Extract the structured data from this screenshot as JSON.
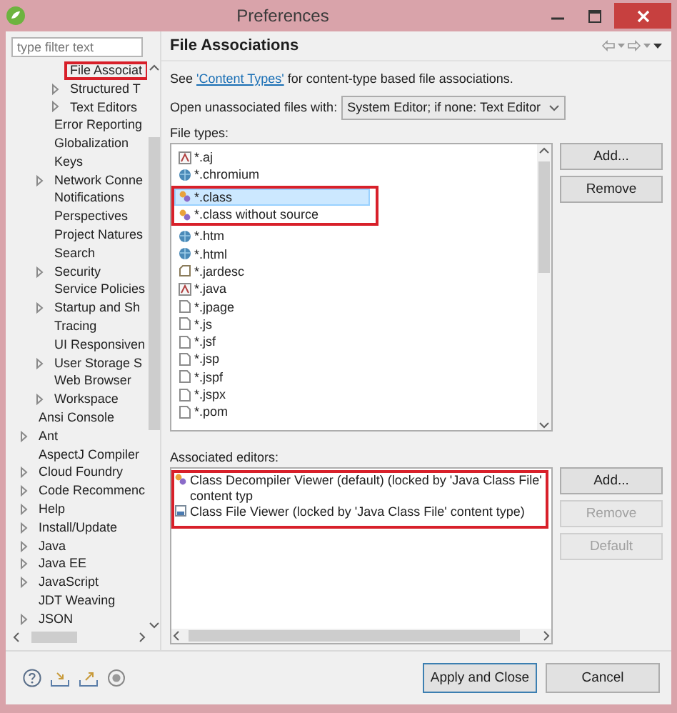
{
  "window": {
    "title": "Preferences"
  },
  "filter": {
    "placeholder": "type filter text"
  },
  "tree": {
    "items": [
      {
        "children": [
          {
            "children": [
              {
                "label": "File Associat",
                "expandable": false,
                "highlighted": true
              },
              {
                "label": "Structured T",
                "expandable": true,
                "highlighted": false
              },
              {
                "label": "Text Editors",
                "expandable": true,
                "highlighted": false
              }
            ]
          },
          {
            "label": "Error Reporting",
            "expandable": false,
            "highlighted": false
          },
          {
            "label": "Globalization",
            "expandable": false,
            "highlighted": false
          },
          {
            "label": "Keys",
            "expandable": false,
            "highlighted": false
          },
          {
            "label": "Network Conne",
            "expandable": true,
            "highlighted": false
          },
          {
            "label": "Notifications",
            "expandable": false,
            "highlighted": false
          },
          {
            "label": "Perspectives",
            "expandable": false,
            "highlighted": false
          },
          {
            "label": "Project Natures",
            "expandable": false,
            "highlighted": false
          },
          {
            "label": "Search",
            "expandable": false,
            "highlighted": false
          },
          {
            "label": "Security",
            "expandable": true,
            "highlighted": false
          },
          {
            "label": "Service Policies",
            "expandable": false,
            "highlighted": false
          },
          {
            "label": "Startup and Sh",
            "expandable": true,
            "highlighted": false
          },
          {
            "label": "Tracing",
            "expandable": false,
            "highlighted": false
          },
          {
            "label": "UI Responsiven",
            "expandable": false,
            "highlighted": false
          },
          {
            "label": "User Storage S",
            "expandable": true,
            "highlighted": false
          },
          {
            "label": "Web Browser",
            "expandable": false,
            "highlighted": false
          },
          {
            "label": "Workspace",
            "expandable": true,
            "highlighted": false
          }
        ]
      },
      {
        "label": "Ansi Console",
        "expandable": false,
        "highlighted": false
      },
      {
        "label": "Ant",
        "expandable": true,
        "highlighted": false
      },
      {
        "label": "AspectJ Compiler",
        "expandable": false,
        "highlighted": false
      },
      {
        "label": "Cloud Foundry",
        "expandable": true,
        "highlighted": false
      },
      {
        "label": "Code Recommenc",
        "expandable": true,
        "highlighted": false
      },
      {
        "label": "Help",
        "expandable": true,
        "highlighted": false
      },
      {
        "label": "Install/Update",
        "expandable": true,
        "highlighted": false
      },
      {
        "label": "Java",
        "expandable": true,
        "highlighted": false
      },
      {
        "label": "Java EE",
        "expandable": true,
        "highlighted": false
      },
      {
        "label": "JavaScript",
        "expandable": true,
        "highlighted": false
      },
      {
        "label": "JDT Weaving",
        "expandable": false,
        "highlighted": false
      },
      {
        "label": "JSON",
        "expandable": true,
        "highlighted": false
      }
    ]
  },
  "page": {
    "title": "File Associations"
  },
  "intro": {
    "before": "See ",
    "link": "'Content Types'",
    "after": " for content-type based file associations."
  },
  "unassociated": {
    "label": "Open unassociated files with:",
    "value": "System Editor; if none: Text Editor"
  },
  "file_types": {
    "label": "File types:",
    "items": [
      {
        "name": "*.aj",
        "kind": "source",
        "selected": false,
        "highlighted": false
      },
      {
        "name": "*.chromium",
        "kind": "globe",
        "selected": false,
        "highlighted": false
      },
      {
        "name": "*.class",
        "kind": "class",
        "selected": true,
        "highlighted": true
      },
      {
        "name": "*.class without source",
        "kind": "class",
        "selected": false,
        "highlighted": true
      },
      {
        "name": "*.htm",
        "kind": "globe",
        "selected": false,
        "highlighted": false
      },
      {
        "name": "*.html",
        "kind": "globe",
        "selected": false,
        "highlighted": false
      },
      {
        "name": "*.jardesc",
        "kind": "jar",
        "selected": false,
        "highlighted": false
      },
      {
        "name": "*.java",
        "kind": "source",
        "selected": false,
        "highlighted": false
      },
      {
        "name": "*.jpage",
        "kind": "file",
        "selected": false,
        "highlighted": false
      },
      {
        "name": "*.js",
        "kind": "file",
        "selected": false,
        "highlighted": false
      },
      {
        "name": "*.jsf",
        "kind": "file",
        "selected": false,
        "highlighted": false
      },
      {
        "name": "*.jsp",
        "kind": "file",
        "selected": false,
        "highlighted": false
      },
      {
        "name": "*.jspf",
        "kind": "file",
        "selected": false,
        "highlighted": false
      },
      {
        "name": "*.jspx",
        "kind": "file",
        "selected": false,
        "highlighted": false
      },
      {
        "name": "*.pom",
        "kind": "file",
        "selected": false,
        "highlighted": false
      }
    ],
    "buttons": [
      {
        "label": "Add...",
        "disabled": false
      },
      {
        "label": "Remove",
        "disabled": false
      }
    ]
  },
  "associated_editors": {
    "label": "Associated editors:",
    "items": [
      {
        "name": "Class Decompiler Viewer (default) (locked by 'Java Class File' content typ",
        "kind": "class",
        "highlighted": true
      },
      {
        "name": "Class File Viewer (locked by 'Java Class File' content type)",
        "kind": "binary",
        "highlighted": true
      }
    ],
    "buttons": [
      {
        "label": "Add...",
        "disabled": false
      },
      {
        "label": "Remove",
        "disabled": true
      },
      {
        "label": "Default",
        "disabled": true
      }
    ]
  },
  "footer": {
    "buttons": [
      {
        "label": "Apply and Close",
        "default": true
      },
      {
        "label": "Cancel",
        "default": false
      }
    ]
  }
}
